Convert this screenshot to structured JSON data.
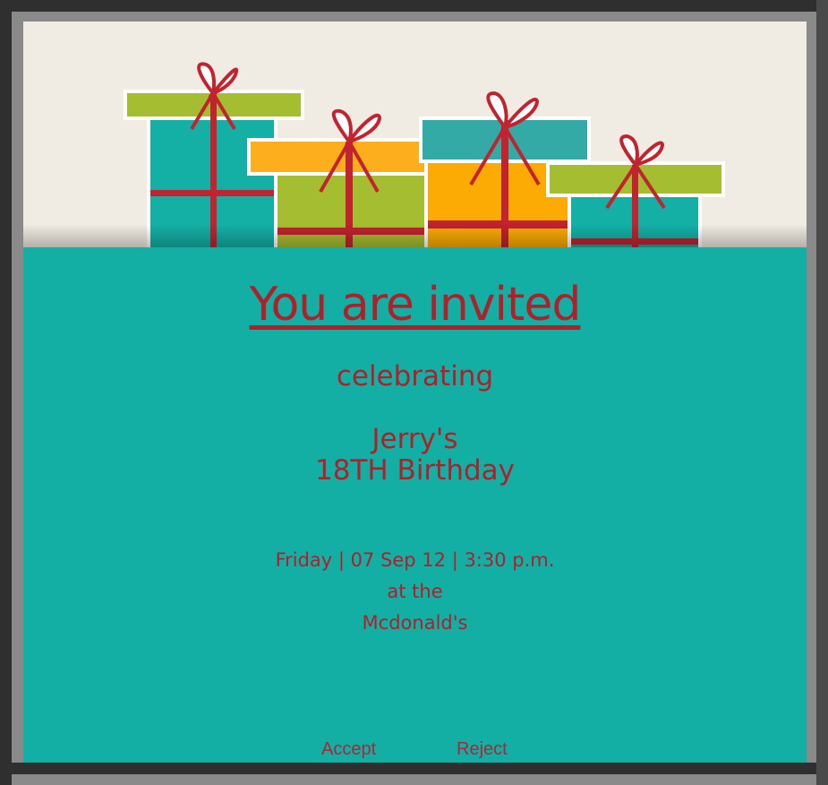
{
  "invitation": {
    "heading": "You are invited",
    "occasion_intro": "celebrating",
    "honoree": "Jerry's",
    "event": "18TH Birthday",
    "datetime": "Friday | 07 Sep 12 | 3:30 p.m.",
    "venue_prefix": "at the",
    "venue": "Mcdonald's"
  },
  "actions": {
    "accept_label": "Accept",
    "reject_label": "Reject"
  },
  "colors": {
    "background": "#13afa4",
    "text": "#b11f29",
    "banner": "#f0ebe3"
  }
}
